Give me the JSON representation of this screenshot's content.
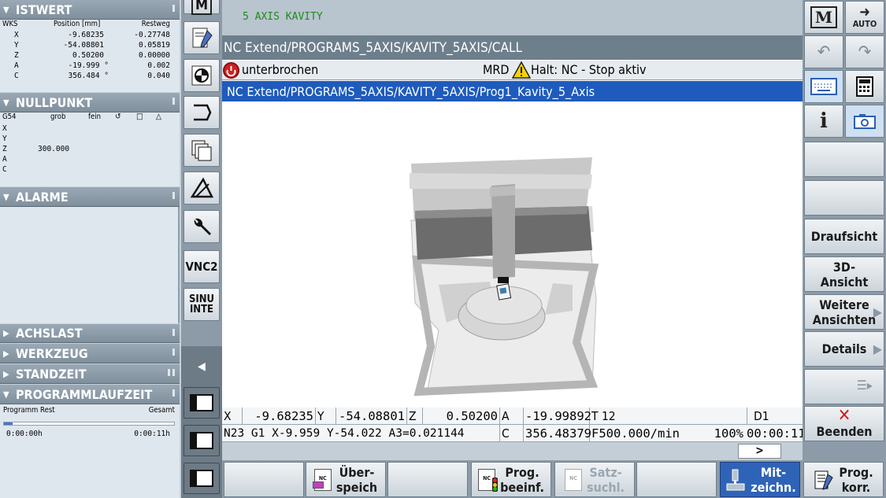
{
  "istwert": {
    "title": "ISTWERT",
    "headers": [
      "WKS",
      "Position [mm]",
      "Restweg"
    ],
    "rows": [
      {
        "axis": "X",
        "pos": "-9.68235",
        "rest": "-0.27748"
      },
      {
        "axis": "Y",
        "pos": "-54.08801",
        "rest": "0.05819"
      },
      {
        "axis": "Z",
        "pos": "0.50200",
        "rest": "0.00000"
      },
      {
        "axis": "A",
        "pos": "-19.999 °",
        "rest": "0.002"
      },
      {
        "axis": "C",
        "pos": "356.484 °",
        "rest": "0.040"
      }
    ]
  },
  "nullpunkt": {
    "title": "NULLPUNKT",
    "headers": [
      "G54",
      "grob",
      "fein"
    ],
    "rows": [
      {
        "axis": "X",
        "val": ""
      },
      {
        "axis": "Y",
        "val": ""
      },
      {
        "axis": "Z",
        "val": "300.000"
      },
      {
        "axis": "A",
        "val": ""
      },
      {
        "axis": "C",
        "val": ""
      }
    ]
  },
  "alarme": {
    "title": "ALARME"
  },
  "collapsed_panels": [
    "ACHSLAST",
    "WERKZEUG",
    "STANDZEIT"
  ],
  "programmlaufzeit": {
    "title": "PROGRAMMLAUFZEIT",
    "label_left": "Programm Rest",
    "label_right": "Gesamt",
    "rest": "0:00:00h",
    "gesamt": "0:00:11h",
    "progress": 0.05
  },
  "vtoolbar": {
    "vnc": "VNC2",
    "sinu_1": "SINU",
    "sinu_2": "INTE",
    "m_label": "M"
  },
  "main": {
    "program_name": "5 AXIS KAVITY",
    "path_call": "NC Extend/PROGRAMS_5AXIS/KAVITY_5AXIS/CALL",
    "status_interrupted": "unterbrochen",
    "status_mode": "MRD",
    "status_halt": "Halt: NC - Stop aktiv",
    "path_prog": "NC Extend/PROGRAMS_5AXIS/KAVITY_5AXIS/Prog1_Kavity_5_Axis"
  },
  "coords": {
    "row1": {
      "x_label": "X",
      "x_val": "-9.68235",
      "y_label": "Y",
      "y_val": "-54.08801",
      "z_label": "Z",
      "z_val": "0.50200",
      "a_label": "A",
      "a_val": "-19.99892",
      "t": "T 12",
      "d": "D1"
    },
    "row2": {
      "block": "N23 G1 X-9.959 Y-54.022 A3=0.021144",
      "c_label": "C",
      "c_val": "356.48379",
      "feed": "F500.000/min",
      "override": "100%",
      "time": "00:00:11"
    },
    "arrow": ">"
  },
  "right_softkeys": {
    "m_label": "M",
    "auto_label": "AUTO",
    "info": "i",
    "draufsicht": "Draufsicht",
    "ansicht3d_1": "3D-",
    "ansicht3d_2": "Ansicht",
    "weitere_1": "Weitere",
    "weitere_2": "Ansichten",
    "details": "Details",
    "beenden": "Beenden"
  },
  "bottom_softkeys": {
    "ueberspeich_1": "Über-",
    "ueberspeich_2": "speich",
    "prog_beeinf_1": "Prog.",
    "prog_beeinf_2": "beeinf.",
    "satz_1": "Satz-",
    "satz_2": "suchl.",
    "mitzeichn_1": "Mit-",
    "mitzeichn_2": "zeichn.",
    "prog_korr_1": "Prog.",
    "prog_korr_2": "korr.",
    "nc_tag": "NC"
  },
  "colors": {
    "accent_blue": "#1e5bbd",
    "path_gray": "#6e7f8c",
    "green_title": "#1f8a1f",
    "alarm_red": "#d02020",
    "warn_yellow": "#f5d400",
    "active_softkey": "#2f63b8"
  }
}
